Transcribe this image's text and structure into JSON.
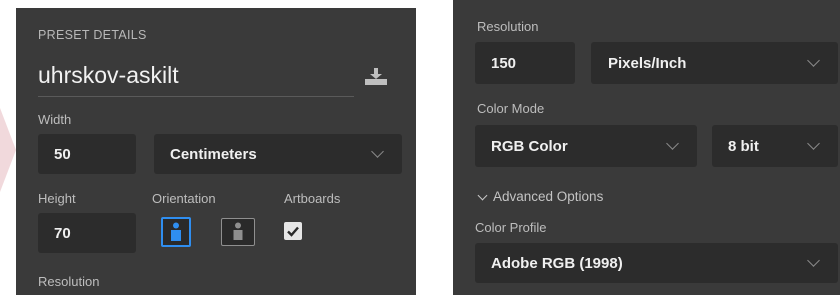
{
  "preset": {
    "section_title": "PRESET DETAILS",
    "name": "uhrskov-askilt",
    "width_label": "Width",
    "width_value": "50",
    "width_unit": "Centimeters",
    "height_label": "Height",
    "height_value": "70",
    "orientation_label": "Orientation",
    "artboards_label": "Artboards",
    "resolution_label": "Resolution"
  },
  "right": {
    "resolution_label": "Resolution",
    "resolution_value": "150",
    "resolution_unit": "Pixels/Inch",
    "color_mode_label": "Color Mode",
    "color_mode_value": "RGB Color",
    "bit_depth_value": "8 bit",
    "advanced_label": "Advanced Options",
    "color_profile_label": "Color Profile",
    "color_profile_value": "Adobe RGB (1998)"
  },
  "icons": {
    "save": "save-preset-icon",
    "portrait": "portrait-orientation-icon",
    "landscape": "landscape-orientation-icon",
    "checkbox": "checkmark-icon",
    "chevron": "chevron-down-icon"
  },
  "colors": {
    "panel_bg": "#3a3a3a",
    "field_bg": "#2c2c2c",
    "accent": "#2f8ef0"
  },
  "state": {
    "orientation_selected": "portrait",
    "artboards_checked": true
  }
}
